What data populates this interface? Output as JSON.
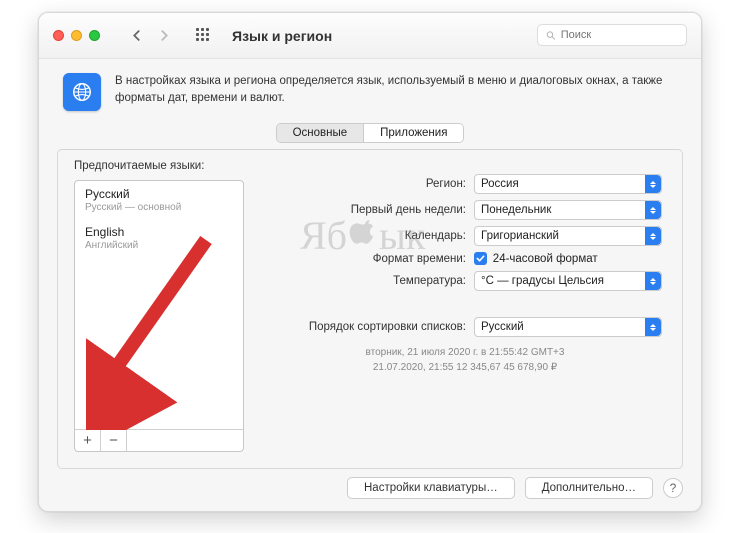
{
  "toolbar": {
    "title": "Язык и регион",
    "search_placeholder": "Поиск"
  },
  "info": {
    "text": "В настройках языка и региона определяется язык, используемый в меню и диалоговых окнах, а также форматы дат, времени и валют."
  },
  "tabs": {
    "general": "Основные",
    "apps": "Приложения"
  },
  "sidebar": {
    "preferred_label": "Предпочитаемые языки:",
    "languages": [
      {
        "name": "Русский",
        "sub": "Русский — основной"
      },
      {
        "name": "English",
        "sub": "Английский"
      }
    ]
  },
  "settings": {
    "region_label": "Регион:",
    "region_value": "Россия",
    "firstday_label": "Первый день недели:",
    "firstday_value": "Понедельник",
    "calendar_label": "Календарь:",
    "calendar_value": "Григорианский",
    "timefmt_label": "Формат времени:",
    "timefmt_value": "24-часовой формат",
    "temperature_label": "Температура:",
    "temperature_value": "°C — градусы Цельсия",
    "sort_label": "Порядок сортировки списков:",
    "sort_value": "Русский"
  },
  "sample": {
    "line1": "вторник, 21 июля 2020 г. в 21:55:42 GMT+3",
    "line2": "21.07.2020, 21:55    12 345,67    45 678,90 ₽"
  },
  "footer": {
    "keyboard": "Настройки клавиатуры…",
    "advanced": "Дополнительно…"
  },
  "watermark": {
    "left": "Яб",
    "right": "ык"
  }
}
